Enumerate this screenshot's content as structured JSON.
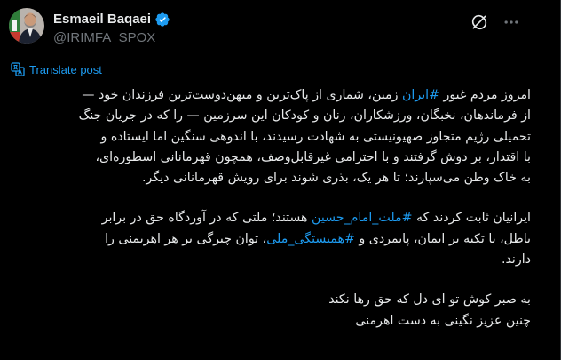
{
  "colors": {
    "background": "#000000",
    "text": "#e7e9ea",
    "muted": "#71767b",
    "accent": "#1d9bf0",
    "divider": "#2f3336"
  },
  "author": {
    "name": "Esmaeil Baqaei",
    "handle": "@IRIMFA_SPOX",
    "verified": true,
    "verified_icon": "verified-badge-icon",
    "avatar_icon": "profile-photo"
  },
  "actions": {
    "grok_icon": "grok-icon",
    "more_icon": "more-dots-icon"
  },
  "translate": {
    "icon": "translate-icon",
    "label": "Translate post"
  },
  "post": {
    "p1": [
      {
        "before": "امروز مردم غیور ",
        "tag": "#ایران",
        "after": " زمین، شماری از پاک‌ترین و میهن‌دوست‌ترین فرزندان خود —"
      },
      "از فرماندهان، نخبگان، ورزشکاران، زنان و کودکان این سرزمین — را که در جریان جنگ",
      "تحمیلی رژیم متجاوز صهیونیستی به شهادت رسیدند، با اندوهی سنگین اما ایستاده و",
      "با اقتدار، بر دوش گرفتند و با احترامی غیرقابل‌وصف، همچون قهرمانانی اسطوره‌ای،",
      "به خاک وطن می‌سپارند؛ تا هر یک، بذری شوند برای رویش قهرمانانی دیگر."
    ],
    "p2_line1": {
      "before": "ایرانیان ثابت کردند که ",
      "tag": "#ملت_امام_حسین",
      "after": " هستند؛ ملتی که در آوردگاه حق در برابر"
    },
    "p2_line2": {
      "before": "باطل، با تکیه بر ایمان، پایمردی و ",
      "tag": "#همبستگی_ملی",
      "after": "، توان چیرگی بر هر اهریمنی را"
    },
    "p2_line3": "دارند.",
    "p3": [
      "به صبر کوش تو ای دل که حق رها نکند",
      "چنین عزیز نگینی به دست اهرمنی"
    ]
  }
}
